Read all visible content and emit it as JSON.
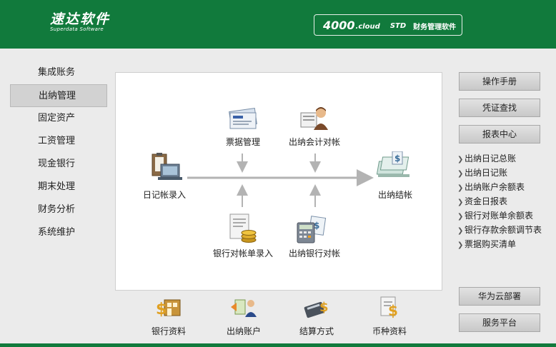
{
  "header": {
    "logo_main": "速达软件",
    "logo_sub": "Superdata Software",
    "product_num": "4000",
    "product_cloud": ".cloud",
    "product_edition": "STD",
    "product_name": "财务管理软件"
  },
  "nav": {
    "items": [
      {
        "label": "集成账务"
      },
      {
        "label": "出纳管理",
        "active": true
      },
      {
        "label": "固定资产"
      },
      {
        "label": "工资管理"
      },
      {
        "label": "现金银行"
      },
      {
        "label": "期末处理"
      },
      {
        "label": "财务分析"
      },
      {
        "label": "系统维护"
      }
    ]
  },
  "flow": {
    "diary_entry": "日记帐录入",
    "bill_mgmt": "票据管理",
    "acct_reconcile": "出纳会计对帐",
    "close": "出纳结帐",
    "bank_stmt_entry": "银行对帐单录入",
    "bank_reconcile": "出纳银行对帐"
  },
  "right": {
    "manual": "操作手册",
    "voucher_search": "凭证查找",
    "report_center": "报表中心",
    "reports": [
      "出纳日记总账",
      "出纳日记账",
      "出纳账户余额表",
      "资金日报表",
      "银行对账单余额表",
      "银行存款余额调节表",
      "票据购买清单"
    ],
    "huawei": "华为云部署",
    "service": "服务平台"
  },
  "bottom": {
    "items": [
      "银行资料",
      "出纳账户",
      "结算方式",
      "币种资料"
    ]
  },
  "colors": {
    "brand_green": "#117a3c",
    "arrow_gray": "#b3b3b3"
  }
}
